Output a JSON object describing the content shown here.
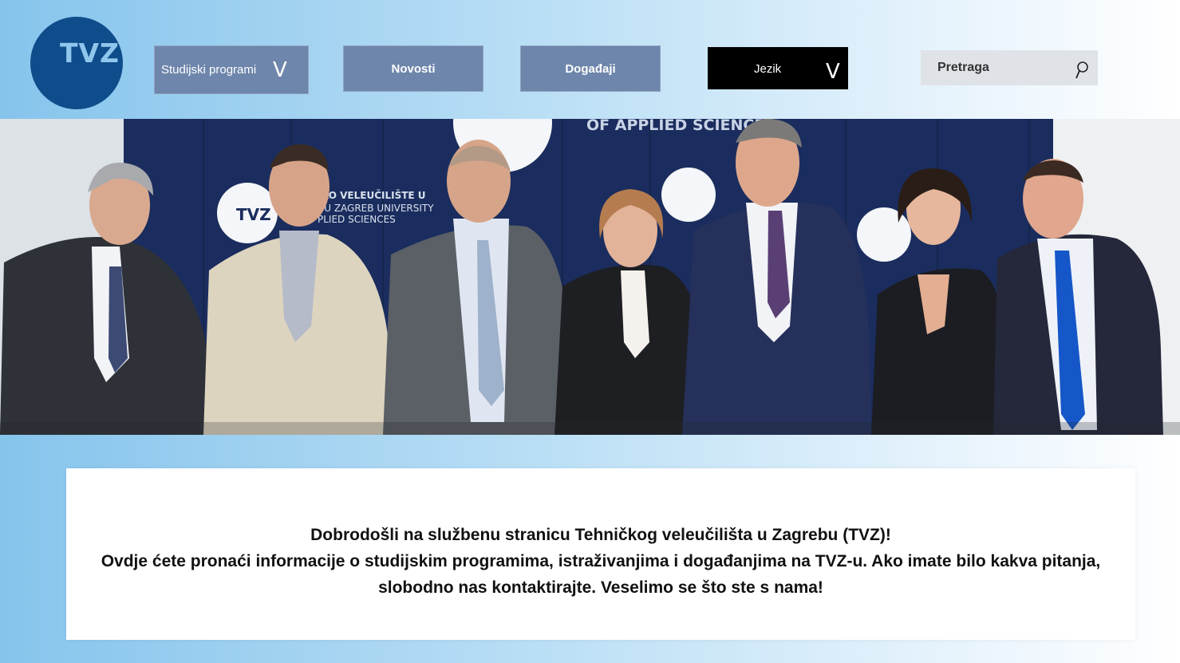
{
  "logo": {
    "text": "TVZ"
  },
  "nav": {
    "programs": {
      "label": "Studijski programi",
      "chevron": "V"
    },
    "news": {
      "label": "Novosti"
    },
    "events": {
      "label": "Događaji"
    },
    "language": {
      "label": "Jezik",
      "chevron": "V"
    }
  },
  "search": {
    "label": "Pretraga",
    "icon": "search-icon"
  },
  "hero": {
    "backdrop_text": {
      "top": "OF APPLIED SCIENCES",
      "left_line1": "KO VELEUČILIŠTE U",
      "left_line2": "BU ZAGREB UNIVERSITY",
      "left_line3": "PLIED SCIENCES",
      "logo": "TVZ"
    }
  },
  "welcome": {
    "line1": "Dobrodošli na službenu stranicu Tehničkog veleučilišta u Zagrebu (TVZ)!",
    "line2": "Ovdje ćete pronaći informacije o studijskim programima, istraživanjima i događanjima na TVZ-u. Ako imate bilo kakva pitanja, slobodno nas kontaktirajte. Veselimo se što ste s nama!"
  },
  "colors": {
    "logo_bg": "#0f4c8b",
    "nav_bg": "#6e86ab",
    "lang_bg": "#000000",
    "search_bg": "#dfe3e8",
    "backdrop": "#1b2d5e"
  }
}
